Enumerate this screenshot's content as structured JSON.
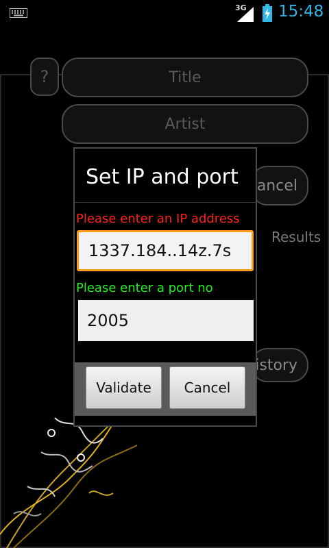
{
  "status_bar": {
    "network_label": "3G",
    "time": "15:48",
    "icons": [
      "keyboard-icon",
      "signal-icon",
      "battery-charging-icon"
    ]
  },
  "background": {
    "help_label": "?",
    "title_placeholder": "Title",
    "artist_placeholder": "Artist",
    "cancel_label": "Cancel",
    "results_label": "Results",
    "history_label": "History"
  },
  "dialog": {
    "title": "Set IP and port",
    "ip_label": "Please enter an IP address",
    "ip_value": "1337.184..14z.7s",
    "port_label": "Please enter a port no",
    "port_value": "2005",
    "validate_label": "Validate",
    "cancel_label": "Cancel"
  },
  "colors": {
    "clock": "#33b5e5",
    "error_label": "#ff2020",
    "ok_label": "#22ee22",
    "focus_border": "#ff9a1a"
  }
}
